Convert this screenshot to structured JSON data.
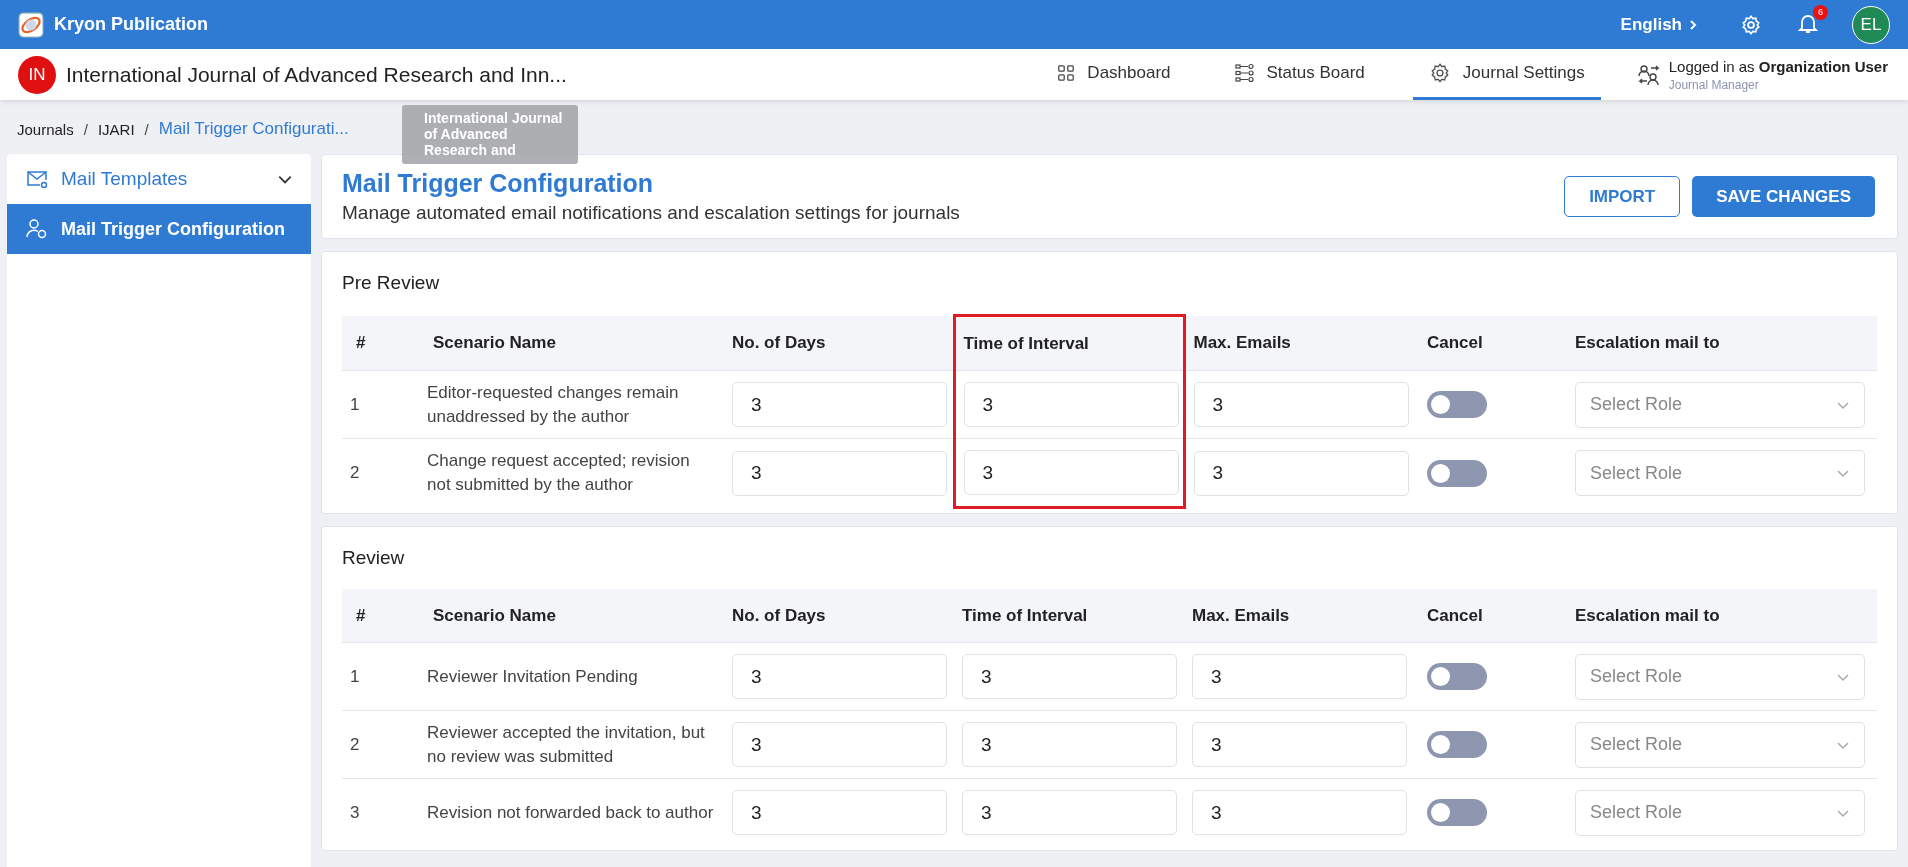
{
  "app_bar": {
    "title": "Kryon Publication",
    "language": "English",
    "notification_count": "6",
    "avatar": "EL"
  },
  "journal_bar": {
    "badge": "IN",
    "title": "International Journal of Advanced Research and Inn...",
    "tooltip": "International Journal of Advanced Research and",
    "nav": [
      {
        "label": "Dashboard",
        "selected": false
      },
      {
        "label": "Status Board",
        "selected": false
      },
      {
        "label": "Journal Settings",
        "selected": true
      }
    ],
    "user": {
      "prefix": "Logged in as",
      "name": "Organization User",
      "role": "Journal Manager"
    }
  },
  "breadcrumb": {
    "separator": "/",
    "items": [
      "Journals",
      "IJARI",
      "Mail Trigger Configurati..."
    ]
  },
  "sidebar": {
    "items": [
      {
        "label": "Mail Templates",
        "selected": false,
        "expandable": true
      },
      {
        "label": "Mail Trigger Configuration",
        "selected": true,
        "expandable": false
      }
    ]
  },
  "header": {
    "title": "Mail Trigger Configuration",
    "subtitle": "Manage automated email notifications and escalation settings for journals",
    "buttons": [
      {
        "label": "IMPORT",
        "kind": "outline"
      },
      {
        "label": "SAVE CHANGES",
        "kind": "primary"
      }
    ]
  },
  "sections": [
    {
      "title": "Pre Review",
      "columns": [
        {
          "label": "#",
          "highlighted": false
        },
        {
          "label": "Scenario Name",
          "highlighted": false
        },
        {
          "label": "No. of Days",
          "highlighted": false
        },
        {
          "label": "Time of Interval",
          "highlighted": true
        },
        {
          "label": "Max. Emails",
          "highlighted": false
        },
        {
          "label": "Cancel",
          "highlighted": false
        },
        {
          "label": "Escalation mail to",
          "highlighted": false
        }
      ],
      "rows": [
        {
          "index": "1",
          "scenario": "Editor-requested changes remain unaddressed by the author",
          "days": "3",
          "interval": "3",
          "max_emails": "3",
          "cancel": false,
          "escalation_placeholder": "Select Role"
        },
        {
          "index": "2",
          "scenario": "Change request accepted; revision not submitted by the author",
          "days": "3",
          "interval": "3",
          "max_emails": "3",
          "cancel": false,
          "escalation_placeholder": "Select Role"
        }
      ]
    },
    {
      "title": "Review",
      "columns": [
        {
          "label": "#",
          "highlighted": false
        },
        {
          "label": "Scenario Name",
          "highlighted": false
        },
        {
          "label": "No. of Days",
          "highlighted": false
        },
        {
          "label": "Time of Interval",
          "highlighted": false
        },
        {
          "label": "Max. Emails",
          "highlighted": false
        },
        {
          "label": "Cancel",
          "highlighted": false
        },
        {
          "label": "Escalation mail to",
          "highlighted": false
        }
      ],
      "rows": [
        {
          "index": "1",
          "scenario": "Reviewer Invitation Pending",
          "days": "3",
          "interval": "3",
          "max_emails": "3",
          "cancel": false,
          "escalation_placeholder": "Select Role"
        },
        {
          "index": "2",
          "scenario": "Reviewer accepted the invitation, but no review was submitted",
          "days": "3",
          "interval": "3",
          "max_emails": "3",
          "cancel": false,
          "escalation_placeholder": "Select Role"
        },
        {
          "index": "3",
          "scenario": "Revision not forwarded back to author",
          "days": "3",
          "interval": "3",
          "max_emails": "3",
          "cancel": false,
          "escalation_placeholder": "Select Role"
        }
      ]
    }
  ]
}
